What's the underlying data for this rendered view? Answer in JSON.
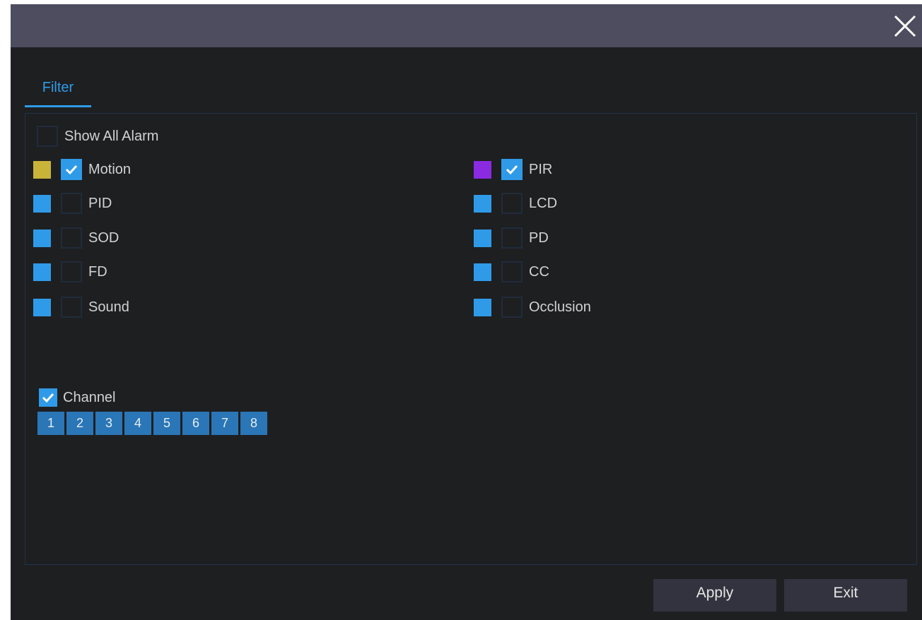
{
  "dialog": {
    "tab_label": "Filter"
  },
  "show_all": {
    "label": "Show All Alarm",
    "checked": false
  },
  "alarm_types": [
    {
      "label": "Motion",
      "color": "#c9b43a",
      "checked": true
    },
    {
      "label": "PID",
      "color": "#2f9be8",
      "checked": false
    },
    {
      "label": "SOD",
      "color": "#2f9be8",
      "checked": false
    },
    {
      "label": "FD",
      "color": "#2f9be8",
      "checked": false
    },
    {
      "label": "Sound",
      "color": "#2f9be8",
      "checked": false
    },
    {
      "label": "PIR",
      "color": "#8a2be2",
      "checked": true
    },
    {
      "label": "LCD",
      "color": "#2f9be8",
      "checked": false
    },
    {
      "label": "PD",
      "color": "#2f9be8",
      "checked": false
    },
    {
      "label": "CC",
      "color": "#2f9be8",
      "checked": false
    },
    {
      "label": "Occlusion",
      "color": "#2f9be8",
      "checked": false
    }
  ],
  "channel": {
    "label": "Channel",
    "checked": true,
    "numbers": [
      "1",
      "2",
      "3",
      "4",
      "5",
      "6",
      "7",
      "8"
    ]
  },
  "buttons": {
    "apply": "Apply",
    "exit": "Exit"
  },
  "icons": {
    "close": "close-icon",
    "check": "checkmark-icon"
  },
  "colors": {
    "accent": "#2f9be8",
    "titlebar": "#4d4d5f",
    "background": "#1e1f21",
    "channel_button": "#2a76b6"
  }
}
